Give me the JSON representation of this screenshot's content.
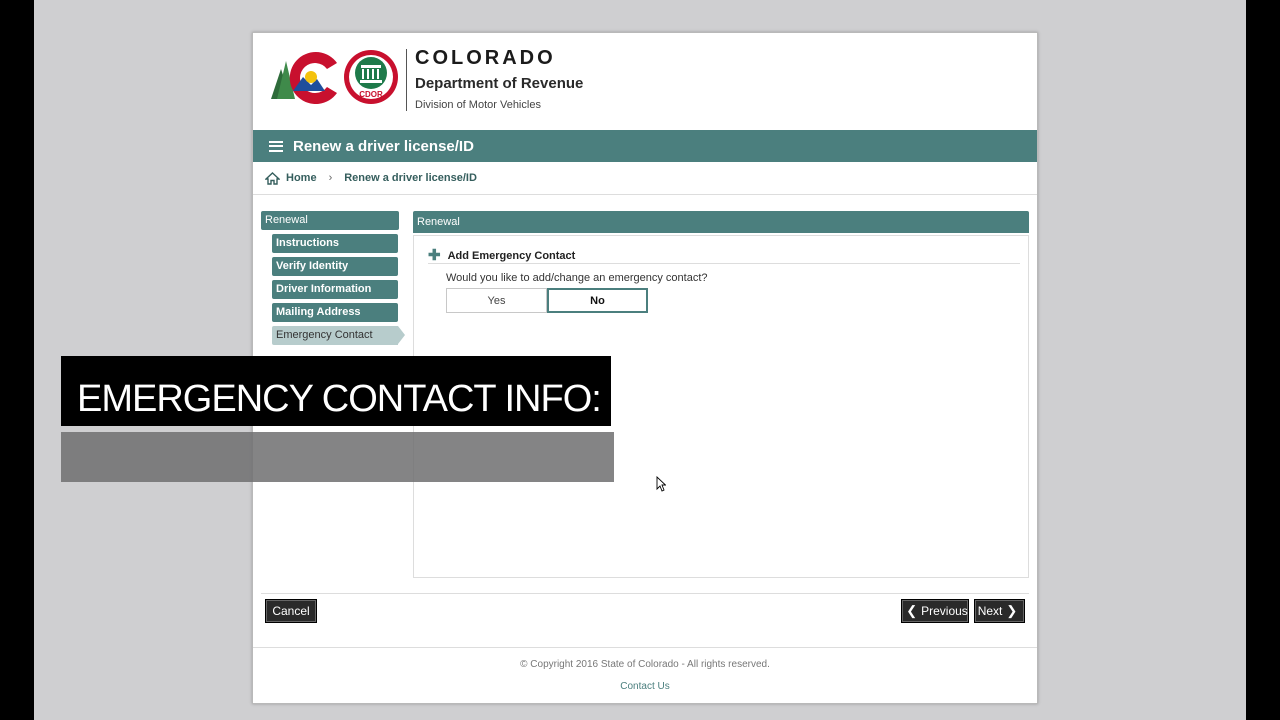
{
  "header": {
    "brand_title": "COLORADO",
    "brand_department": "Department of Revenue",
    "brand_division": "Division of Motor Vehicles",
    "seal_label": "CDOR"
  },
  "titlebar": {
    "title": "Renew a driver license/ID"
  },
  "breadcrumb": {
    "home": "Home",
    "separator": "›",
    "current": "Renew a driver license/ID"
  },
  "leftnav": {
    "heading": "Renewal",
    "items": [
      {
        "label": "Instructions"
      },
      {
        "label": "Verify Identity"
      },
      {
        "label": "Driver Information"
      },
      {
        "label": "Mailing Address"
      },
      {
        "label": "Emergency Contact",
        "active": true
      }
    ]
  },
  "panel": {
    "heading": "Renewal",
    "section_title": "Add Emergency Contact",
    "question": "Would you like to add/change an emergency contact?",
    "options": {
      "yes": "Yes",
      "no": "No",
      "selected": "No"
    }
  },
  "actions": {
    "cancel": "Cancel",
    "previous": "Previous",
    "next": "Next"
  },
  "footer": {
    "copyright": "© Copyright 2016 State of Colorado - All rights reserved.",
    "contact": "Contact Us"
  },
  "overlay": {
    "caption": "EMERGENCY CONTACT INFO:"
  },
  "colors": {
    "teal": "#4b7f7e",
    "teal_light": "#b7cccc",
    "dark_button": "#2a2a2a"
  }
}
